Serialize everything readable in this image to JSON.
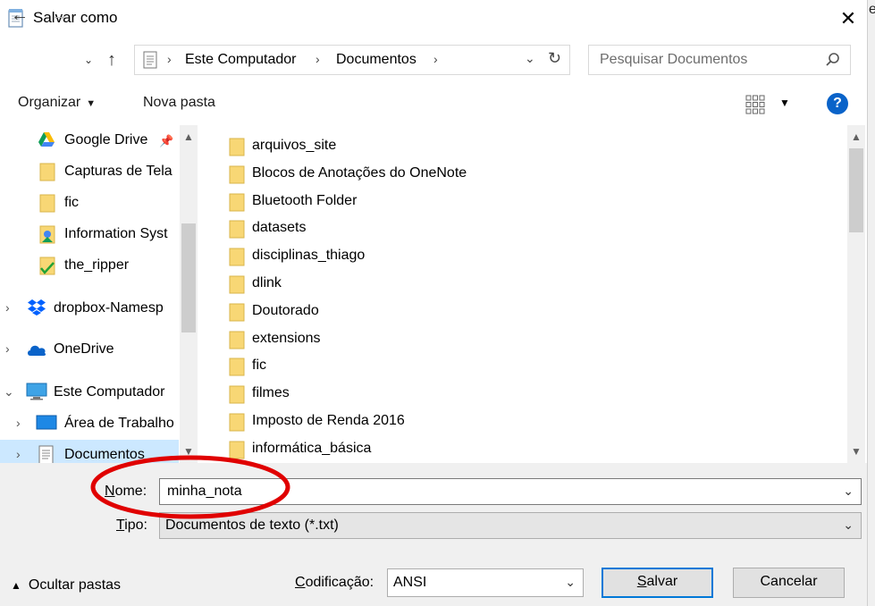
{
  "window": {
    "title": "Salvar como",
    "edge_char": "e"
  },
  "address": {
    "crumbs": [
      "Este Computador",
      "Documentos"
    ]
  },
  "search": {
    "placeholder": "Pesquisar Documentos"
  },
  "toolbar": {
    "organize": "Organizar",
    "new_folder": "Nova pasta"
  },
  "nav_pane": {
    "items": [
      {
        "label": "Google Drive",
        "icon": "google-drive-icon"
      },
      {
        "label": "Capturas de Tela",
        "icon": "folder-icon"
      },
      {
        "label": "fic",
        "icon": "folder-icon"
      },
      {
        "label": "Information Syst",
        "icon": "folder-sync-icon"
      },
      {
        "label": "the_ripper",
        "icon": "folder-check-icon"
      },
      {
        "label": "dropbox-Namesp",
        "icon": "dropbox-icon"
      },
      {
        "label": "OneDrive",
        "icon": "onedrive-cloud-icon"
      },
      {
        "label": "Este Computador",
        "icon": "computer-icon"
      },
      {
        "label": "Área de Trabalho",
        "icon": "desktop-icon"
      },
      {
        "label": "Documentos",
        "icon": "documents-icon"
      }
    ]
  },
  "files": [
    "arquivos_site",
    "Blocos de Anotações do OneNote",
    "Bluetooth Folder",
    "datasets",
    "disciplinas_thiago",
    "dlink",
    "Doutorado",
    "extensions",
    "fic",
    "filmes",
    "Imposto de Renda 2016",
    "informática_básica"
  ],
  "form": {
    "name_label_first": "N",
    "name_label_rest": "ome:",
    "name_value": "minha_nota",
    "type_label_first": "T",
    "type_label_rest": "ipo:",
    "type_value": "Documentos de texto (*.txt)",
    "encoding_label_first": "C",
    "encoding_label_rest": "odificação:",
    "encoding_value": "ANSI",
    "hide_folders": "Ocultar pastas",
    "save_first": "S",
    "save_rest": "alvar",
    "cancel": "Cancelar"
  },
  "colors": {
    "accent": "#0078d7",
    "selection": "#cce8ff",
    "annotation": "#e00000",
    "folder": "#f8d775"
  }
}
